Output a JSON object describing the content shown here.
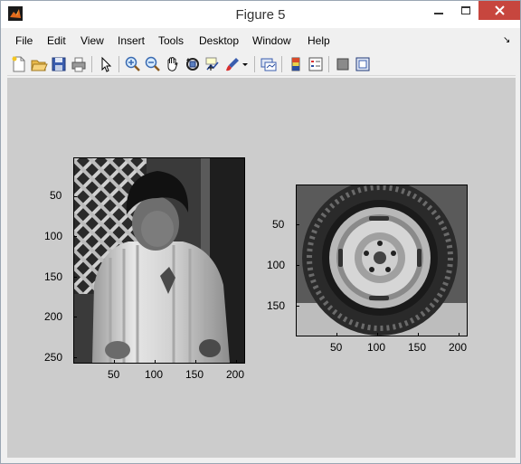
{
  "window": {
    "title": "Figure 5"
  },
  "menu": {
    "items": [
      "File",
      "Edit",
      "View",
      "Insert",
      "Tools",
      "Desktop",
      "Window",
      "Help"
    ]
  },
  "toolbar": {
    "icons": [
      "new-file",
      "open-file",
      "save",
      "print",
      "pointer",
      "zoom-in",
      "zoom-out",
      "pan-hand",
      "rotate-3d",
      "data-cursor",
      "brush",
      "link",
      "colorbar",
      "legend",
      "hide-plot-tools",
      "show-plot-tools"
    ]
  },
  "colors": {
    "figure_bg": "#cccccc",
    "close_button": "#c7463e"
  },
  "axes": [
    {
      "name": "child-image",
      "xticks": [
        "50",
        "100",
        "150",
        "200"
      ],
      "yticks": [
        "50",
        "100",
        "150",
        "200",
        "250"
      ]
    },
    {
      "name": "tire-image",
      "xticks": [
        "50",
        "100",
        "150",
        "200"
      ],
      "yticks": [
        "50",
        "100",
        "150"
      ]
    }
  ]
}
